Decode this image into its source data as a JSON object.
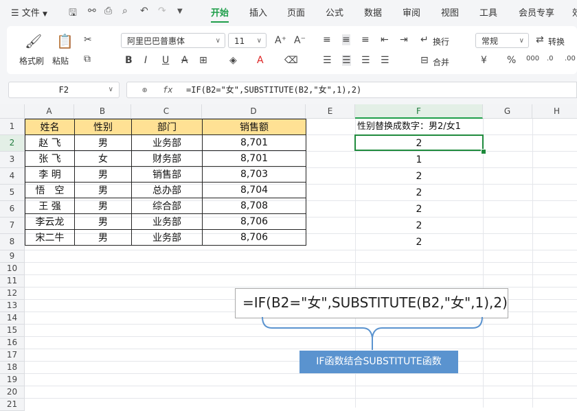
{
  "menubar": {
    "hamburger": "☰",
    "file_label": "文件",
    "tabs": [
      {
        "label": "开始",
        "active": true
      },
      {
        "label": "插入"
      },
      {
        "label": "页面"
      },
      {
        "label": "公式"
      },
      {
        "label": "数据"
      },
      {
        "label": "审阅"
      },
      {
        "label": "视图"
      },
      {
        "label": "工具"
      },
      {
        "label": "会员专享"
      },
      {
        "label": "效"
      }
    ]
  },
  "ribbon": {
    "format_painter": "格式刷",
    "paste": "粘贴",
    "font_name": "阿里巴巴普惠体",
    "font_size": "11",
    "wrap": "换行",
    "number_format": "常规",
    "convert": "转换",
    "merge": "合并"
  },
  "formula_bar": {
    "cell_ref": "F2",
    "fx": "fx",
    "formula": "=IF(B2=\"女\",SUBSTITUTE(B2,\"女\",1),2)"
  },
  "columns": [
    "A",
    "B",
    "C",
    "D",
    "E",
    "F",
    "G",
    "H"
  ],
  "rows": [
    "1",
    "2",
    "3",
    "4",
    "5",
    "6",
    "7",
    "8",
    "9",
    "10",
    "11",
    "12",
    "13",
    "14",
    "15",
    "16",
    "17",
    "18",
    "19",
    "20",
    "21"
  ],
  "table": {
    "headers": [
      "姓名",
      "性别",
      "部门",
      "销售额"
    ],
    "rows": [
      [
        "赵 飞",
        "男",
        "业务部",
        "8,701"
      ],
      [
        "张 飞",
        "女",
        "财务部",
        "8,701"
      ],
      [
        "李 明",
        "男",
        "销售部",
        "8,703"
      ],
      [
        "悟　空",
        "男",
        "总办部",
        "8,704"
      ],
      [
        "王 强",
        "男",
        "综合部",
        "8,708"
      ],
      [
        "李云龙",
        "男",
        "业务部",
        "8,706"
      ],
      [
        "宋二牛",
        "男",
        "业务部",
        "8,706"
      ]
    ]
  },
  "f_column": {
    "header": "性别替换成数字：男2/女1",
    "values": [
      "2",
      "1",
      "2",
      "2",
      "2",
      "2",
      "2"
    ]
  },
  "callout": {
    "formula": "=IF(B2=\"女\",SUBSTITUTE(B2,\"女\",1),2)",
    "label": "IF函数结合SUBSTITUTE函数"
  },
  "colors": {
    "accent": "#1e9e4a",
    "header_fill": "#ffe194",
    "label_fill": "#5a93cf"
  }
}
